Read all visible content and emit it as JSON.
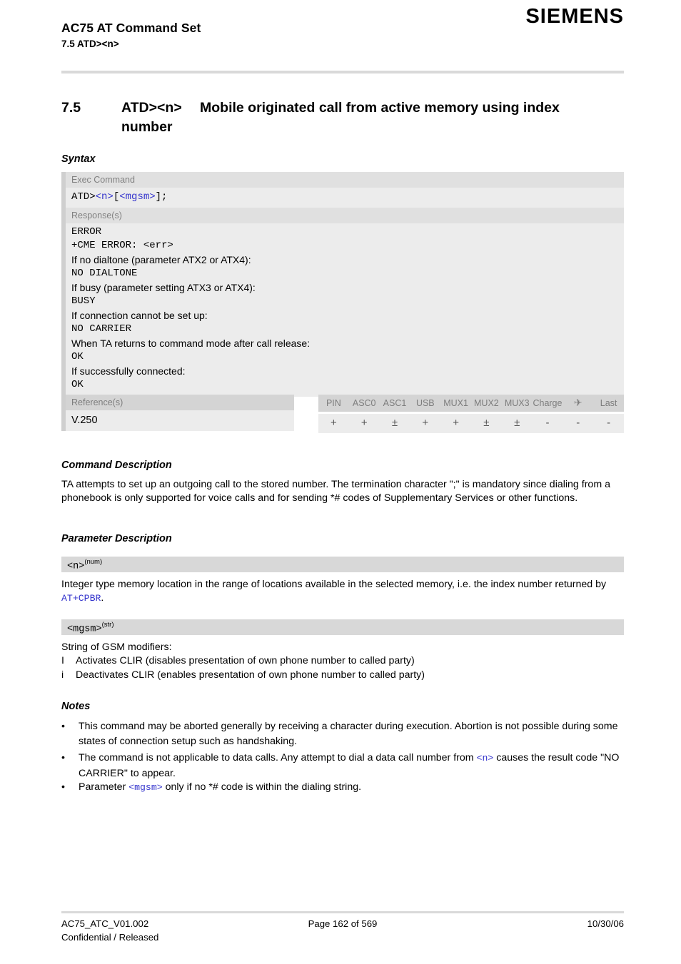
{
  "header": {
    "doc_title": "AC75 AT Command Set",
    "doc_subtitle": "7.5 ATD><n>",
    "brand": "SIEMENS"
  },
  "section": {
    "number": "7.5",
    "command": "ATD><n>",
    "title_line1": "Mobile originated call from active memory using index",
    "title_line2": "number"
  },
  "subheads": {
    "syntax": "Syntax",
    "command_description": "Command Description",
    "parameter_description": "Parameter Description",
    "notes": "Notes"
  },
  "syntax": {
    "exec_label": "Exec Command",
    "exec_command": {
      "prefix": "ATD>",
      "param1": "<n>",
      "bracket_open": "[",
      "param2": "<mgsm>",
      "bracket_close": "];"
    },
    "response_label": "Response(s)",
    "response_lines": [
      {
        "text": "ERROR",
        "style": "code"
      },
      {
        "text": "+CME ERROR: <err>",
        "style": "code"
      },
      {
        "text": "If no dialtone (parameter ATX2 or ATX4):",
        "style": "prose"
      },
      {
        "text": "NO DIALTONE",
        "style": "code"
      },
      {
        "text": "If busy (parameter setting ATX3 or ATX4):",
        "style": "prose"
      },
      {
        "text": "BUSY",
        "style": "code"
      },
      {
        "text": "If connection cannot be set up:",
        "style": "prose"
      },
      {
        "text": "NO CARRIER",
        "style": "code"
      },
      {
        "text": "When TA returns to command mode after call release:",
        "style": "prose"
      },
      {
        "text": "OK",
        "style": "code"
      },
      {
        "text": "If successfully connected:",
        "style": "prose"
      },
      {
        "text": "OK",
        "style": "code"
      }
    ]
  },
  "reference": {
    "label": "Reference(s)",
    "value": "V.250"
  },
  "capability": {
    "columns": [
      "PIN",
      "ASC0",
      "ASC1",
      "USB",
      "MUX1",
      "MUX2",
      "MUX3",
      "Charge",
      "airplane-icon",
      "Last"
    ],
    "values": [
      "+",
      "+",
      "±",
      "+",
      "+",
      "±",
      "±",
      "-",
      "-",
      "-"
    ]
  },
  "command_description": {
    "text": "TA attempts to set up an outgoing call to the stored number. The termination character \";\" is mandatory since dialing from a phonebook is only supported for voice calls and for sending *# codes of Supplementary Services or other functions."
  },
  "parameters": [
    {
      "name": "<n>",
      "type": "(num)",
      "desc_pre": "Integer type memory location in the range of locations available in the selected memory, i.e. the index number returned by ",
      "desc_link": "AT+CPBR",
      "desc_post": "."
    },
    {
      "name": "<mgsm>",
      "type": "(str)",
      "desc_pre": "String of GSM modifiers:",
      "modifiers": [
        {
          "key": "I",
          "text": "Activates CLIR (disables presentation of own phone number to called party)"
        },
        {
          "key": "i",
          "text": "Deactivates CLIR (enables presentation of own phone number to called party)"
        }
      ]
    }
  ],
  "notes": {
    "bullet": "•",
    "items": [
      {
        "parts": [
          {
            "t": "This command may be aborted generally by receiving a character during execution. Abortion is not possible during some states of connection setup such as handshaking.",
            "style": "plain"
          }
        ]
      },
      {
        "parts": [
          {
            "t": "The command is not applicable to data calls. Any attempt to dial a data call number from ",
            "style": "plain"
          },
          {
            "t": "<n>",
            "style": "mono-blue"
          },
          {
            "t": " causes the result code \"NO CARRIER\" to appear.",
            "style": "plain"
          }
        ]
      },
      {
        "parts": [
          {
            "t": "Parameter ",
            "style": "plain"
          },
          {
            "t": "<mgsm>",
            "style": "mono-blue"
          },
          {
            "t": " only if no *# code is within the dialing string.",
            "style": "plain"
          }
        ]
      }
    ]
  },
  "footer": {
    "doc_id": "AC75_ATC_V01.002",
    "page": "Page 162 of 569",
    "date": "10/30/06",
    "classification": "Confidential / Released"
  }
}
